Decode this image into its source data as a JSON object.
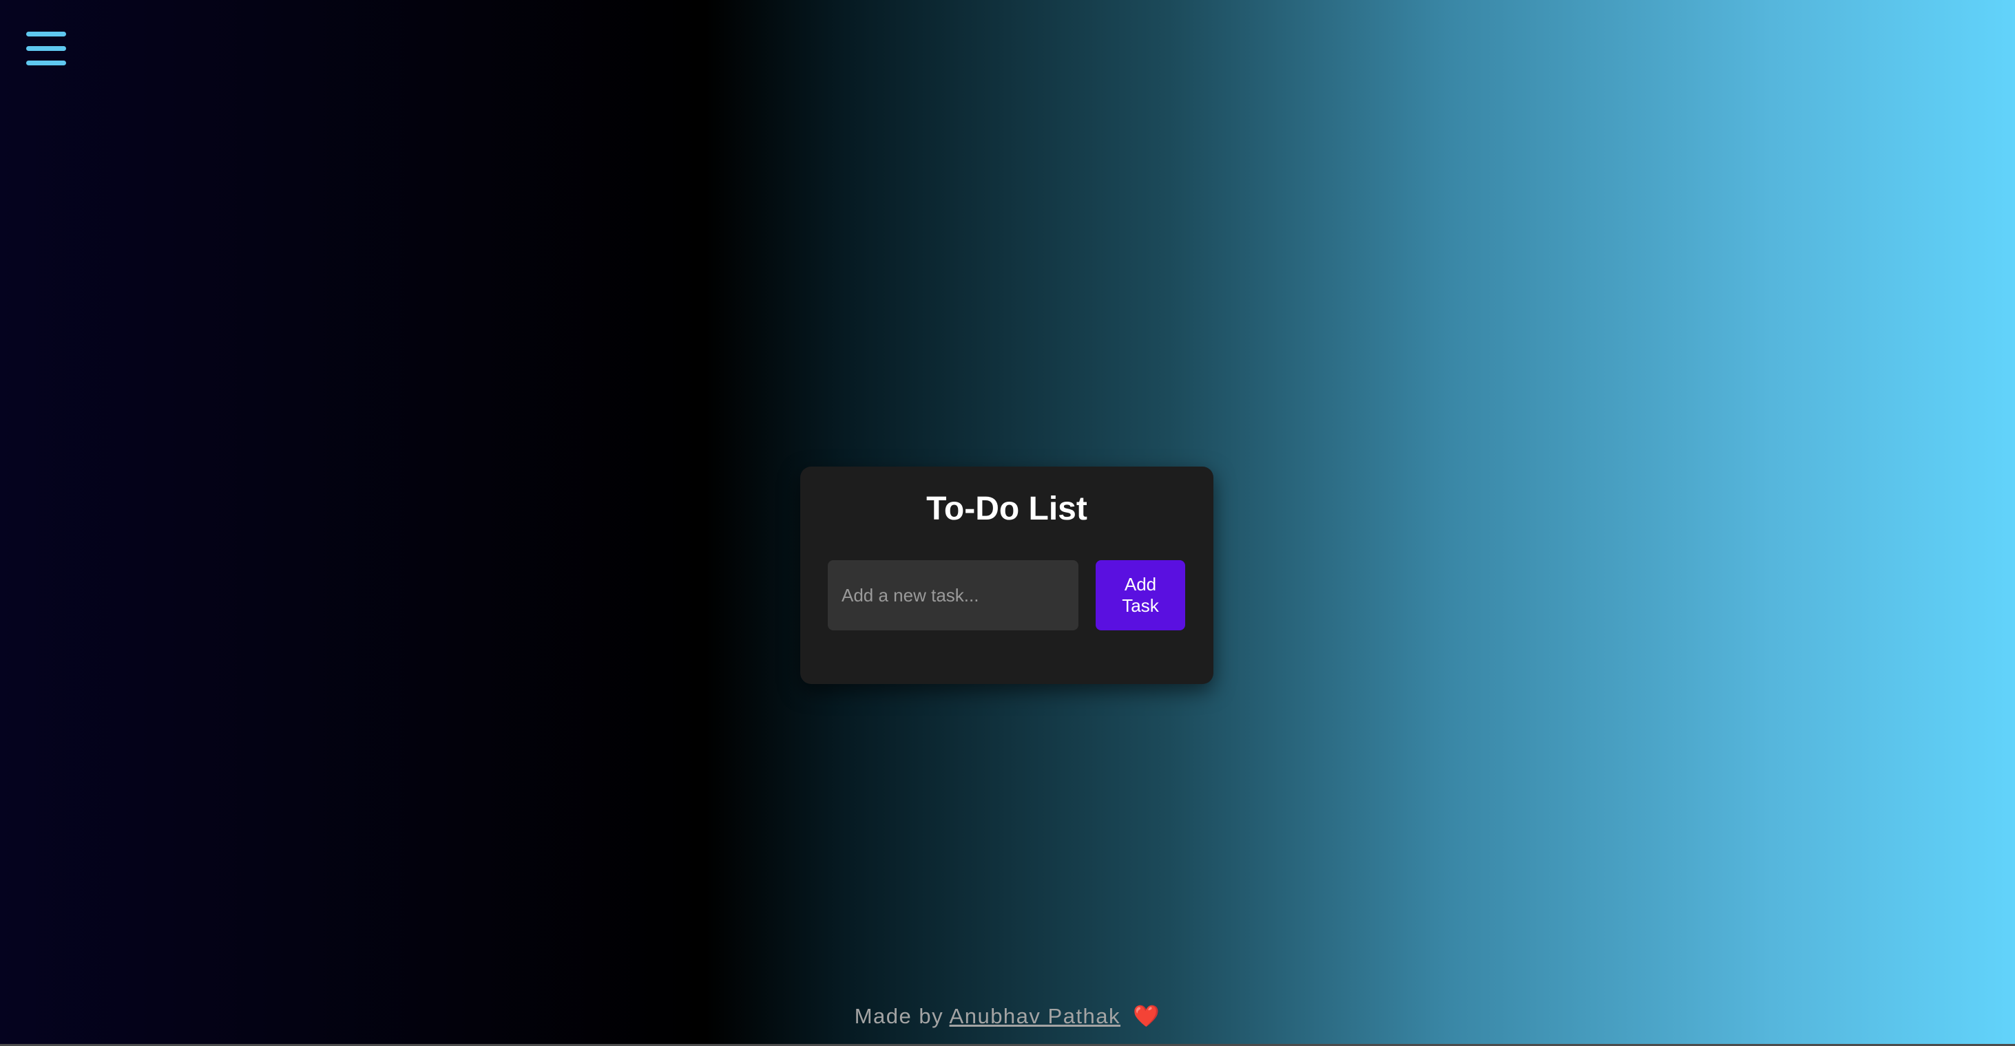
{
  "app": {
    "title": "To-Do List"
  },
  "menu": {
    "icon": "hamburger-menu-icon"
  },
  "task_form": {
    "input_value": "",
    "input_placeholder": "Add a new task...",
    "add_button_label": "Add Task"
  },
  "footer": {
    "prefix": "Made by",
    "author": "Anubhav Pathak",
    "heart": "❤️"
  },
  "colors": {
    "background_gradient": [
      "#05031f",
      "#000000",
      "#1c4a5a",
      "#56b6dc",
      "#62d3fb"
    ],
    "card_background": "#1d1d1d",
    "input_background": "#333333",
    "button_accent": "#5a10e0",
    "menu_icon": "#5fc8ef"
  }
}
